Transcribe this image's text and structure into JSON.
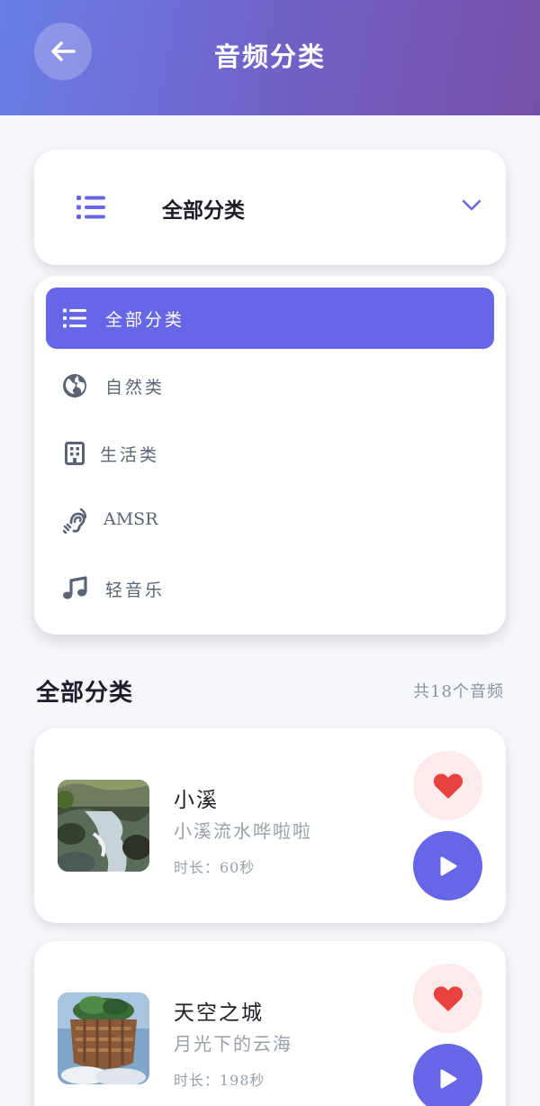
{
  "header": {
    "title": "音频分类"
  },
  "selector": {
    "label": "全部分类"
  },
  "categories": [
    {
      "label": "全部分类",
      "icon": "list-icon",
      "active": true
    },
    {
      "label": "自然类",
      "icon": "globe-icon",
      "active": false
    },
    {
      "label": "生活类",
      "icon": "building-icon",
      "active": false
    },
    {
      "label": "AMSR",
      "icon": "ear-listen-icon",
      "active": false
    },
    {
      "label": "轻音乐",
      "icon": "music-note-icon",
      "active": false
    }
  ],
  "section": {
    "title": "全部分类",
    "count": "共18个音频"
  },
  "audios": [
    {
      "title": "小溪",
      "subtitle": "小溪流水哗啦啦",
      "duration": "时长：60秒"
    },
    {
      "title": "天空之城",
      "subtitle": "月光下的云海",
      "duration": "时长：198秒"
    }
  ],
  "colors": {
    "accent": "#6766e6",
    "favorite": "#e8413f",
    "favorite_bg": "#fdeaea"
  }
}
